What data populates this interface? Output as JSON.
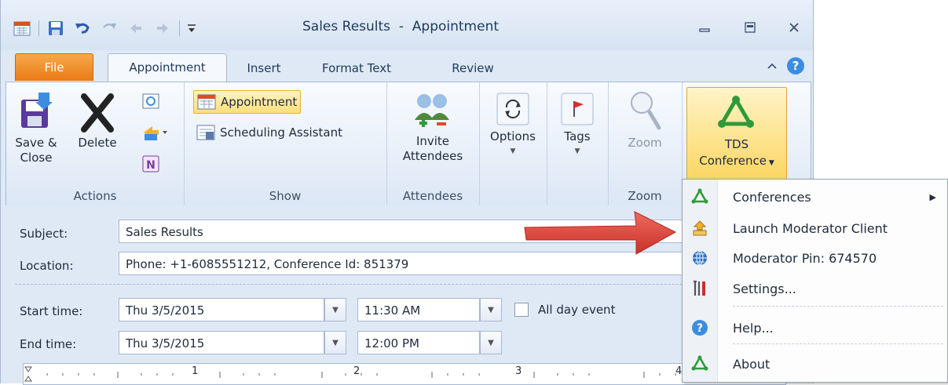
{
  "window": {
    "title": "Sales Results  -  Appointment",
    "controls": {
      "minimize_icon": "minimize-icon",
      "restore_icon": "restore-icon",
      "close_icon": "close-icon"
    }
  },
  "tabs": [
    {
      "label": "File"
    },
    {
      "label": "Appointment"
    },
    {
      "label": "Insert"
    },
    {
      "label": "Format Text"
    },
    {
      "label": "Review"
    }
  ],
  "ribbon": {
    "actions": {
      "save_close": "Save &\nClose",
      "delete": "Delete",
      "group": "Actions"
    },
    "show": {
      "appointment": "Appointment",
      "scheduling": "Scheduling Assistant",
      "group": "Show"
    },
    "attendees": {
      "invite": "Invite\nAttendees",
      "group": "Attendees"
    },
    "options": {
      "label": "Options"
    },
    "tags": {
      "label": "Tags"
    },
    "zoom": {
      "label": "Zoom",
      "group": "Zoom"
    },
    "tds": {
      "line1": "TDS",
      "line2": "Conference"
    }
  },
  "form": {
    "subject_label": "Subject:",
    "subject_value": "Sales Results",
    "location_label": "Location:",
    "location_value": "Phone: +1-6085551212, Conference Id: 851379",
    "start_label": "Start time:",
    "start_date": "Thu 3/5/2015",
    "start_time": "11:30 AM",
    "all_day": "All day event",
    "end_label": "End time:",
    "end_date": "Thu 3/5/2015",
    "end_time": "12:00 PM"
  },
  "ruler": {
    "ticks": [
      "1",
      "2",
      "3",
      "4"
    ]
  },
  "menu": {
    "items": [
      {
        "label": "Conferences",
        "icon": "tds-logo-icon",
        "has_submenu": true
      },
      {
        "label": "Launch Moderator Client",
        "icon": "launch-icon"
      },
      {
        "label": "Moderator Pin: 674570",
        "icon": "globe-icon"
      },
      {
        "label": "Settings...",
        "icon": "tools-icon"
      },
      {
        "label": "Help...",
        "icon": "help-icon"
      },
      {
        "label": "About",
        "icon": "tds-logo-icon"
      }
    ]
  },
  "colors": {
    "file_tab": "#e97a16",
    "highlight": "#fddf7a",
    "arrow": "#e0443a",
    "tds_green": "#2f9a3a"
  }
}
